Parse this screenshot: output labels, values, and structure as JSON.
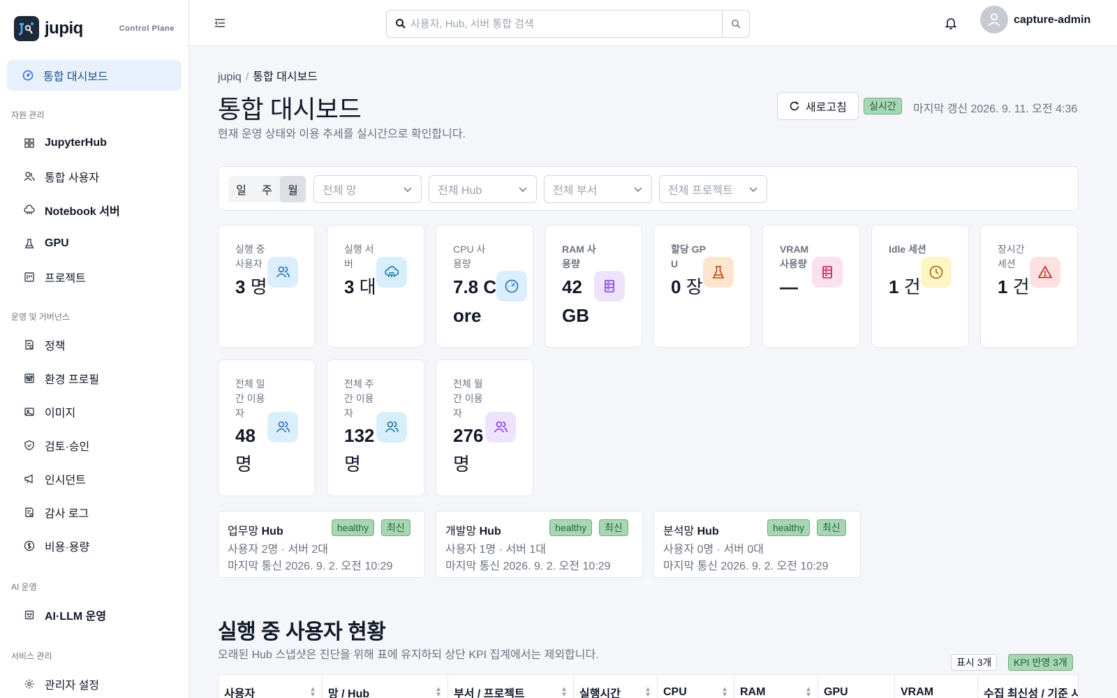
{
  "brand": {
    "name": "jupiq",
    "subtitle": "Control Plane"
  },
  "sidebar": {
    "active": {
      "label": "통합 대시보드",
      "icon": "dashboard-icon"
    },
    "sections": [
      {
        "title": "자원 관리",
        "items": [
          {
            "label": "JupyterHub",
            "bold": true,
            "icon": "grid-icon"
          },
          {
            "label": "통합 사용자",
            "bold": false,
            "icon": "users-icon"
          },
          {
            "label": "Notebook 서버",
            "bold": true,
            "icon": "cloud-server-icon"
          },
          {
            "label": "GPU",
            "bold": true,
            "icon": "flask-icon"
          },
          {
            "label": "프로젝트",
            "bold": false,
            "icon": "project-icon"
          }
        ]
      },
      {
        "title": "운영 및 거버넌스",
        "items": [
          {
            "label": "정책",
            "icon": "policy-icon"
          },
          {
            "label": "환경 프로필",
            "icon": "sliders-icon"
          },
          {
            "label": "이미지",
            "icon": "image-icon"
          },
          {
            "label": "검토·승인",
            "icon": "shield-check-icon"
          },
          {
            "label": "인시던트",
            "icon": "megaphone-icon"
          },
          {
            "label": "감사 로그",
            "icon": "audit-icon"
          },
          {
            "label": "비용·용량",
            "icon": "dollar-icon"
          }
        ]
      },
      {
        "title": "AI 운영",
        "items": [
          {
            "label": "AI·LLM 운영",
            "bold": true,
            "icon": "bot-icon"
          }
        ]
      },
      {
        "title": "서비스 관리",
        "items": [
          {
            "label": "관리자 설정",
            "icon": "gear-icon"
          }
        ]
      }
    ]
  },
  "header": {
    "search_placeholder": "사용자, Hub, 서버 통합 검색",
    "user": "capture-admin"
  },
  "breadcrumb": {
    "root": "jupiq",
    "sep": "/",
    "current": "통합 대시보드"
  },
  "page": {
    "title": "통합 대시보드",
    "subtitle": "현재 운영 상태와 이용 추세를 실시간으로 확인합니다.",
    "refresh_label": "새로고침",
    "live_badge": "실시간",
    "last_update": "마지막 갱신 2026. 9. 11. 오전 4:36"
  },
  "filters": {
    "periods": [
      "일",
      "주",
      "월"
    ],
    "active_period": "월",
    "selects": [
      "전체 망",
      "전체 Hub",
      "전체 부서",
      "전체 프로젝트"
    ]
  },
  "kpis": [
    {
      "label": "실행 중 사용자",
      "value": "3",
      "unit": "명",
      "icon": "users-icon",
      "color": "blue"
    },
    {
      "label": "실행 서버",
      "value": "3",
      "unit": "대",
      "icon": "cloud-server-icon",
      "color": "teal"
    },
    {
      "label": "CPU 사용량",
      "value": "7.8",
      "unit": "Core",
      "icon": "gauge-icon",
      "color": "blue"
    },
    {
      "label": "RAM 사용량",
      "value": "42",
      "unit": "GB",
      "icon": "server-icon",
      "color": "purple"
    },
    {
      "label": "할당 GPU",
      "value": "0",
      "unit": "장",
      "icon": "flask-icon",
      "color": "orange"
    },
    {
      "label": "VRAM 사용량",
      "value": "—",
      "unit": "",
      "icon": "server-icon",
      "color": "pink"
    },
    {
      "label": "Idle 세션",
      "value": "1",
      "unit": "건",
      "icon": "clock-icon",
      "color": "yellow"
    },
    {
      "label": "장시간 세션",
      "value": "1",
      "unit": "건",
      "icon": "alert-icon",
      "color": "red"
    },
    {
      "label": "전체 일간 이용자",
      "value": "48",
      "unit": "명",
      "icon": "users-icon",
      "color": "blue"
    },
    {
      "label": "전체 주간 이용자",
      "value": "132",
      "unit": "명",
      "icon": "users-icon",
      "color": "teal"
    },
    {
      "label": "전체 월간 이용자",
      "value": "276",
      "unit": "명",
      "icon": "users-icon",
      "color": "purple"
    }
  ],
  "hubs": [
    {
      "net": "업무망",
      "name": "Hub",
      "status": "healthy",
      "fresh": "최신",
      "stats": "사용자 2명 · 서버 2대",
      "last": "마지막 통신 2026. 9. 2. 오전 10:29"
    },
    {
      "net": "개발망",
      "name": "Hub",
      "status": "healthy",
      "fresh": "최신",
      "stats": "사용자 1명 · 서버 1대",
      "last": "마지막 통신 2026. 9. 2. 오전 10:29"
    },
    {
      "net": "분석망",
      "name": "Hub",
      "status": "healthy",
      "fresh": "최신",
      "stats": "사용자 0명 · 서버 0대",
      "last": "마지막 통신 2026. 9. 2. 오전 10:29"
    }
  ],
  "section": {
    "title": "실행 중 사용자 현황",
    "subtitle": "오래된 Hub 스냅샷은 진단을 위해 표에 유지하되 상단 KPI 집계에서는 제외합니다.",
    "shown_badge": "표시 3개",
    "kpi_badge": "KPI 반영 3개",
    "columns": [
      "사용자",
      "망 / Hub",
      "부서 / 프로젝트",
      "실행시간",
      "CPU",
      "RAM",
      "GPU",
      "VRAM",
      "수집 최신성 / 기준 시각"
    ]
  }
}
